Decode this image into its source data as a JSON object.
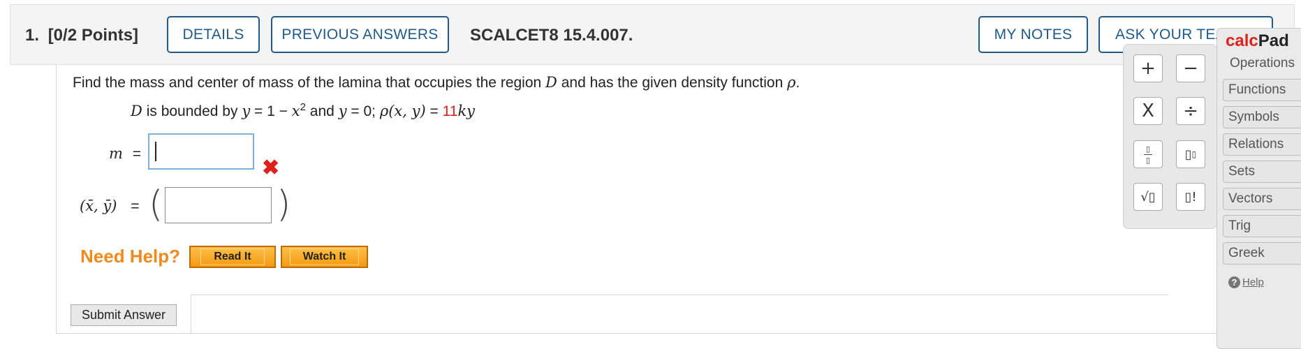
{
  "header": {
    "question_number": "1.",
    "points": "[0/2 Points]",
    "details_label": "DETAILS",
    "previous_answers_label": "PREVIOUS ANSWERS",
    "problem_code": "SCALCET8 15.4.007.",
    "my_notes_label": "MY NOTES",
    "ask_teacher_label": "ASK YOUR TEA"
  },
  "question": {
    "prompt_before_D": "Find the mass and center of mass of the lamina that occupies the region",
    "D": "D",
    "prompt_middle": "and has the given density function",
    "rho": "ρ",
    "period": ".",
    "sub_D": "D",
    "sub_bounded": "is bounded by",
    "y1": "y",
    "eq1": "= 1 −",
    "x2": "x",
    "exp": "2",
    "and": "and",
    "y2": "y",
    "eq0": "= 0;",
    "rho_func": "ρ(x, y)",
    "equals": "=",
    "coef": "11",
    "ky": "ky"
  },
  "answers": {
    "mass_label": "m",
    "mass_equals": "=",
    "mass_value": "",
    "mass_status": "✖",
    "center_label": "(x̄, ȳ)",
    "center_equals": "=",
    "paren_open": "(",
    "paren_close": ")",
    "center_value": ""
  },
  "help": {
    "need_help": "Need Help?",
    "read_it": "Read It",
    "watch_it": "Watch It"
  },
  "submit_label": "Submit Answer",
  "calcpad": {
    "title_calc": "calc",
    "title_pad": "Pad",
    "operations_label": "Operations",
    "buttons": {
      "plus": "+",
      "minus": "−",
      "times": "X",
      "divide": "÷",
      "power_base": "▯",
      "power_exp": "▯",
      "sqrt": "√▯",
      "factorial": "▯!",
      "frac_num": "▯",
      "frac_den": "▯"
    },
    "tabs": [
      "Functions",
      "Symbols",
      "Relations",
      "Sets",
      "Vectors",
      "Trig",
      "Greek"
    ],
    "help_q": "?",
    "help_label": "Help"
  },
  "colors": {
    "brand_blue": "#1e5a8a",
    "error_red": "#e0201a",
    "help_orange": "#f08a1c"
  }
}
